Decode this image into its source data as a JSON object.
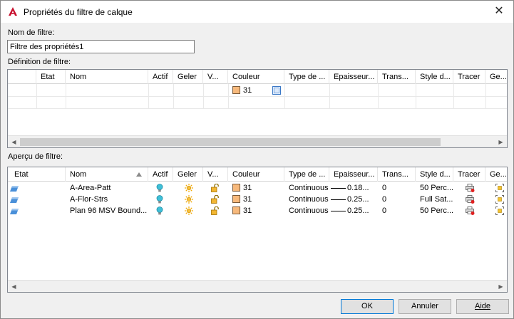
{
  "window": {
    "title": "Propriétés du filtre de calque",
    "close_glyph": "✕"
  },
  "filter_name": {
    "label": "Nom de filtre:",
    "value": "Filtre des propriétés1"
  },
  "definition": {
    "label": "Définition de filtre:",
    "columns": [
      "",
      "Etat",
      "Nom",
      "Actif",
      "Geler",
      "V...",
      "Couleur",
      "Type de ...",
      "Epaisseur...",
      "Trans...",
      "Style d...",
      "Tracer",
      "Ge..."
    ],
    "rows": [
      {
        "color": "31"
      }
    ]
  },
  "preview": {
    "label": "Aperçu de filtre:",
    "columns": [
      "Etat",
      "Nom",
      "Actif",
      "Geler",
      "V...",
      "Couleur",
      "Type de ...",
      "Epaisseur...",
      "Trans...",
      "Style d...",
      "Tracer",
      "Ge..."
    ],
    "rows": [
      {
        "name": "A-Area-Patt",
        "color": "31",
        "linetype": "Continuous",
        "lineweight": "0.18...",
        "transparency": "0",
        "plot_style": "50 Perc..."
      },
      {
        "name": "A-Flor-Strs",
        "color": "31",
        "linetype": "Continuous",
        "lineweight": "0.25...",
        "transparency": "0",
        "plot_style": "Full Sat..."
      },
      {
        "name": "Plan 96 MSV Bound...",
        "color": "31",
        "linetype": "Continuous",
        "lineweight": "0.25...",
        "transparency": "0",
        "plot_style": "50 Perc..."
      }
    ]
  },
  "buttons": {
    "ok": "OK",
    "cancel": "Annuler",
    "help": "Aide"
  },
  "colors": {
    "swatch": "#f7b97c",
    "accent": "#0078d7",
    "bulb": "#3fc0d8",
    "sun": "#f2a900",
    "lock": "#e0a000"
  }
}
